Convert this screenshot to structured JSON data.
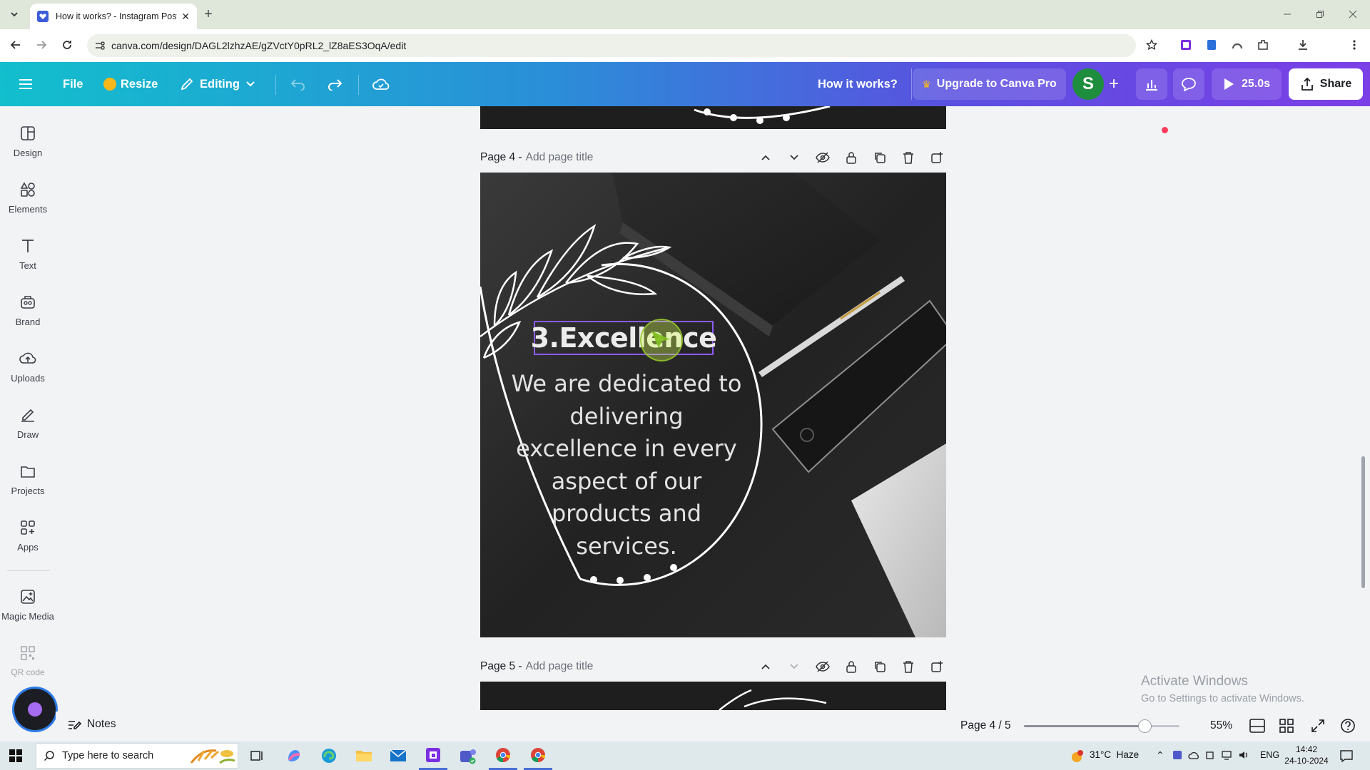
{
  "browser": {
    "tab_title": "How it works? - Instagram Post",
    "url": "canva.com/design/DAGL2lzhzAE/gZVctY0pRL2_lZ8aES3OqA/edit"
  },
  "header": {
    "file_label": "File",
    "resize_label": "Resize",
    "editing_label": "Editing",
    "design_title": "How it works?",
    "upgrade_label": "Upgrade to Canva Pro",
    "avatar_letter": "S",
    "play_duration": "25.0s",
    "share_label": "Share"
  },
  "sidebar": {
    "items": [
      {
        "label": "Design",
        "icon": "design-icon"
      },
      {
        "label": "Elements",
        "icon": "elements-icon"
      },
      {
        "label": "Text",
        "icon": "text-icon"
      },
      {
        "label": "Brand",
        "icon": "brand-icon"
      },
      {
        "label": "Uploads",
        "icon": "uploads-icon"
      },
      {
        "label": "Draw",
        "icon": "draw-icon"
      },
      {
        "label": "Projects",
        "icon": "projects-icon"
      },
      {
        "label": "Apps",
        "icon": "apps-icon"
      },
      {
        "label": "Magic Media",
        "icon": "magic-media-icon"
      },
      {
        "label": "QR code",
        "icon": "qr-code-icon"
      }
    ]
  },
  "pages": {
    "page4": {
      "label": "Page 4 -",
      "title_placeholder": "Add page title"
    },
    "page5": {
      "label": "Page 5 -",
      "title_placeholder": "Add page title"
    }
  },
  "slide": {
    "heading": "3.Excellence",
    "body_lines": [
      "We are dedicated to",
      "delivering",
      "excellence in every",
      "aspect of our",
      "products and",
      "services."
    ]
  },
  "bottom": {
    "notes_label": "Notes",
    "page_indicator": "Page 4 / 5",
    "zoom_percent": 55,
    "zoom_label": "55%"
  },
  "watermark": {
    "title": "Activate Windows",
    "subtitle": "Go to Settings to activate Windows."
  },
  "taskbar": {
    "search_placeholder": "Type here to search",
    "weather": "31°C  Haze",
    "language": "ENG",
    "time": "14:42",
    "date": "24-10-2024"
  },
  "colors": {
    "header_gradient_start": "#12bfcd",
    "header_gradient_end": "#7b3fe6",
    "avatar": "#1e8e3e",
    "selection": "#8b5cf6"
  }
}
